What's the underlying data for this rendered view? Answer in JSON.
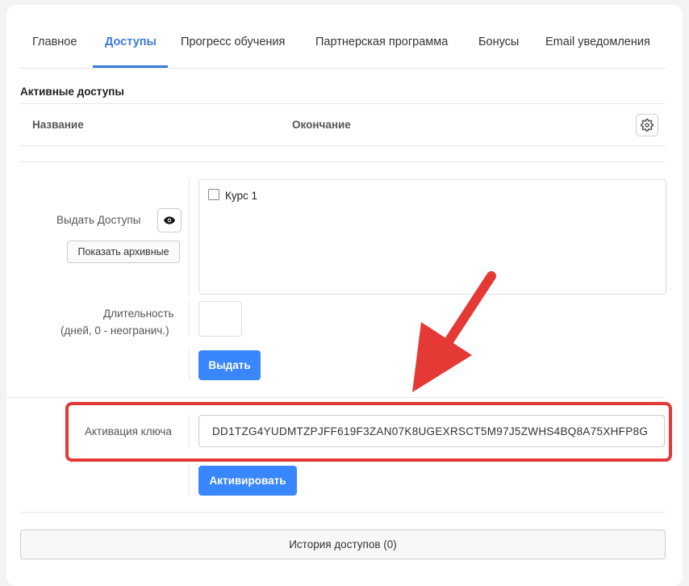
{
  "tabs": [
    {
      "label": "Главное",
      "active": false
    },
    {
      "label": "Доступы",
      "active": true
    },
    {
      "label": "Прогресс обучения",
      "active": false
    },
    {
      "label": "Партнерская программа",
      "active": false
    },
    {
      "label": "Бонусы",
      "active": false
    },
    {
      "label": "Email уведомления",
      "active": false
    }
  ],
  "active_access": {
    "title": "Активные доступы",
    "col_name": "Название",
    "col_end": "Окончание",
    "settings_icon": "gear-icon"
  },
  "grant": {
    "label": "Выдать Доступы",
    "eye_icon": "eye-icon",
    "show_archived_label": "Показать архивные",
    "courses": [
      {
        "label": "Курс 1",
        "checked": false
      }
    ],
    "duration_label_line1": "Длительность",
    "duration_label_line2": "(дней, 0 - неогранич.)",
    "duration_value": "",
    "submit_label": "Выдать"
  },
  "key_activation": {
    "label": "Активация ключа",
    "key_value": "DD1TZG4YUDMTZPJFF619F3ZAN07K8UGEXRSCT5M97J5ZWHS4BQ8A75XHFP8G",
    "submit_label": "Активировать"
  },
  "history_label": "История доступов (0)",
  "colors": {
    "accent": "#3a86ff",
    "tab_active": "#3a7bd5",
    "highlight": "#e53935"
  }
}
